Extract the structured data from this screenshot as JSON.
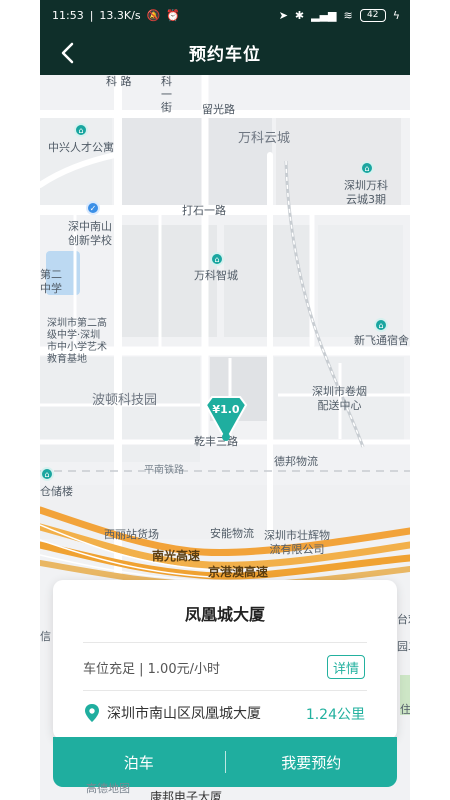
{
  "status": {
    "time": "11:53",
    "speed": "13.3K/s",
    "battery": "42"
  },
  "nav": {
    "title": "预约车位",
    "back_icon": "chevron-left-icon"
  },
  "map": {
    "labels": {
      "kelu": "科\n路",
      "keyi_street": "科\n一\n街",
      "liuguang_road": "留光路",
      "wanke_yuncheng": "万科云城",
      "zhongxing_apartment": "中兴人才公寓",
      "shenzhen_wanke_3": "深圳万科\n云城3期",
      "dashi_1_road": "打石一路",
      "shenzhong_school": "深中南山\n创新学校",
      "wanke_zhicheng": "万科智城",
      "second_school": "第二\n中学",
      "shenzhen_school_2": "深圳市第二高\n级中学·深圳\n市中小学艺术\n教育基地",
      "xinfei_dorm": "新飞通宿舍",
      "boton_park": "波顿科技园",
      "qianfeng_3_road": "乾丰三路",
      "shenzhen_tobacco": "深圳市卷烟\n配送中心",
      "debang": "德邦物流",
      "pingnan_rail": "平南铁路",
      "cang_storage": "仓储楼",
      "xili_station": "西丽站货场",
      "anneng": "安能物流",
      "zhuanghui": "深圳市壮辉物\n流有限公司",
      "nanguang_expressway": "南光高速",
      "jinggang_expressway": "京港澳高速",
      "xin_left": "信",
      "right_edge_1": "台戏",
      "right_edge_2": "园二",
      "right_edge_3": "住",
      "logo": "高德地图",
      "bottom_fragment": "康邦电子大厦"
    },
    "marker_price": "¥1.0"
  },
  "card": {
    "title": "凤凰城大厦",
    "price_text": "车位充足 | 1.00元/小时",
    "detail_label": "详情",
    "address": "深圳市南山区凤凰城大厦",
    "distance": "1.24公里"
  },
  "actions": {
    "park": "泊车",
    "reserve": "我要预约"
  },
  "colors": {
    "header": "#0f2f2a",
    "accent": "#1fae9f",
    "highway": "#f2a33a",
    "map_bg": "#f1f2f4"
  }
}
